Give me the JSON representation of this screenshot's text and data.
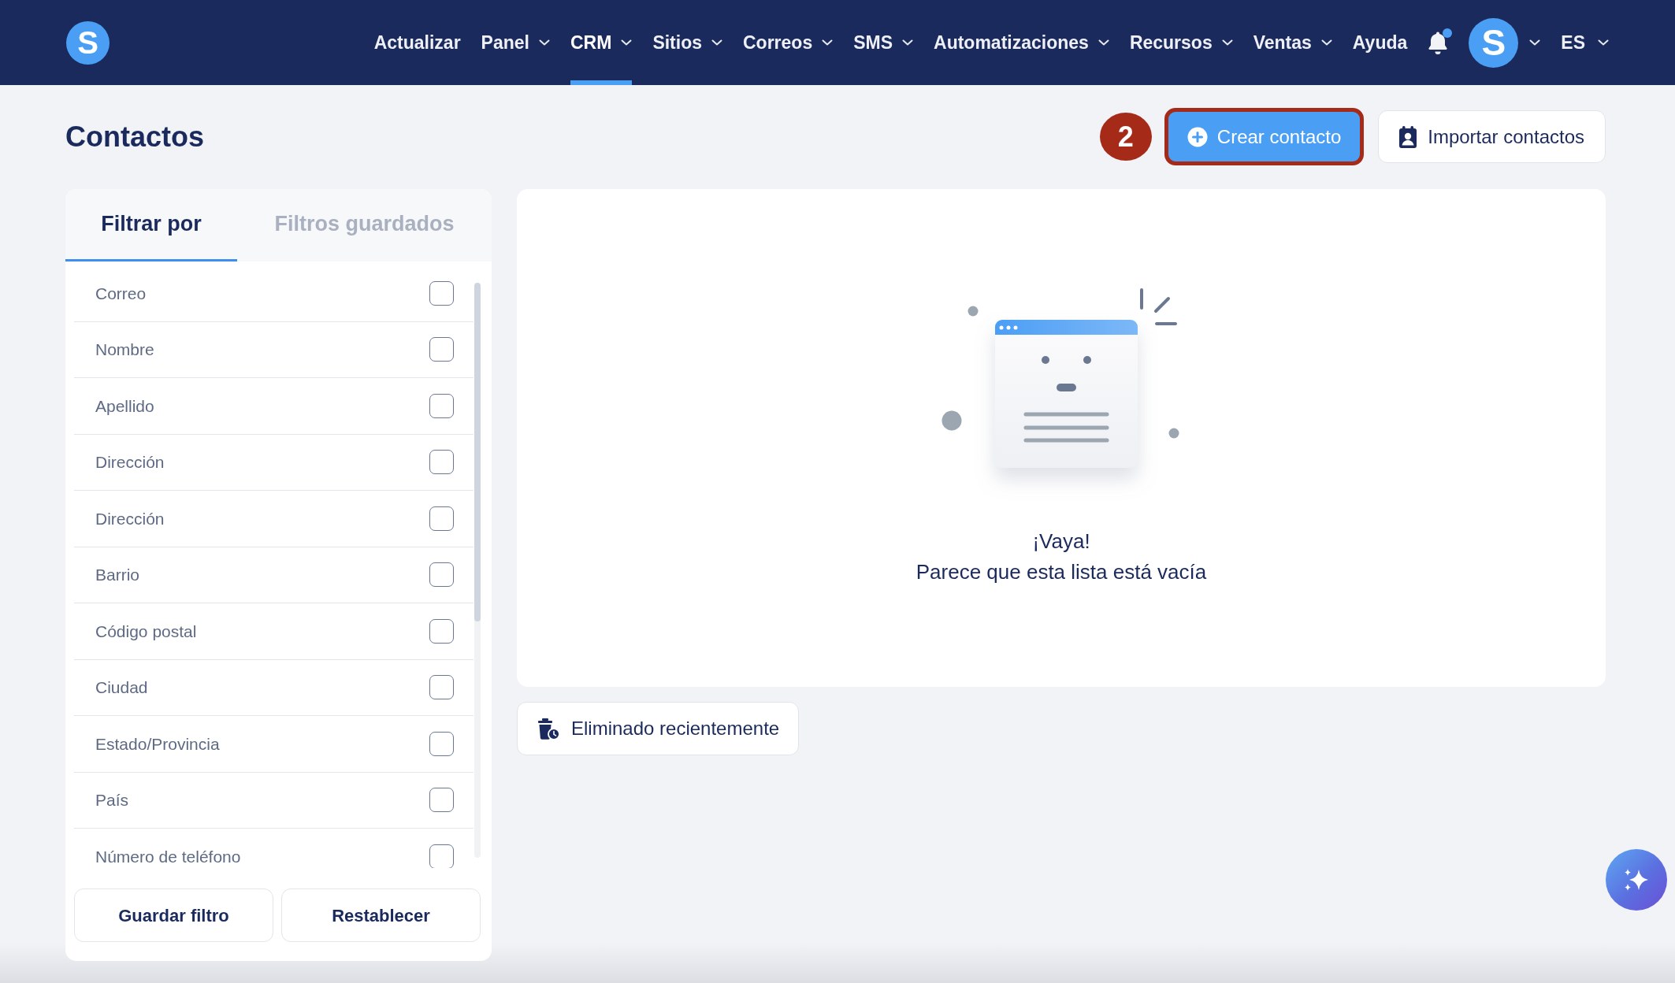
{
  "navbar": {
    "logo": "S",
    "items": [
      {
        "label": "Actualizar",
        "dropdown": false,
        "selected": false
      },
      {
        "label": "Panel",
        "dropdown": true,
        "selected": false
      },
      {
        "label": "CRM",
        "dropdown": true,
        "selected": true
      },
      {
        "label": "Sitios",
        "dropdown": true,
        "selected": false
      },
      {
        "label": "Correos",
        "dropdown": true,
        "selected": false
      },
      {
        "label": "SMS",
        "dropdown": true,
        "selected": false
      },
      {
        "label": "Automatizaciones",
        "dropdown": true,
        "selected": false
      },
      {
        "label": "Recursos",
        "dropdown": true,
        "selected": false
      },
      {
        "label": "Ventas",
        "dropdown": true,
        "selected": false
      },
      {
        "label": "Ayuda",
        "dropdown": false,
        "selected": false
      }
    ],
    "notification": {
      "unread": true
    },
    "avatar": {
      "initial": "S",
      "dropdown": true
    },
    "language": {
      "label": "ES",
      "dropdown": true
    }
  },
  "page": {
    "title": "Contactos",
    "step_marker": "2",
    "actions": [
      {
        "kind": "create",
        "label": "Crear contacto",
        "highlighted": true
      },
      {
        "kind": "import",
        "label": "Importar contactos",
        "highlighted": false
      }
    ]
  },
  "filters": {
    "tabs": [
      {
        "label": "Filtrar por",
        "selected": true
      },
      {
        "label": "Filtros guardados",
        "selected": false
      }
    ],
    "fields": [
      {
        "label": "Correo",
        "checked": false
      },
      {
        "label": "Nombre",
        "checked": false
      },
      {
        "label": "Apellido",
        "checked": false
      },
      {
        "label": "Dirección",
        "checked": false
      },
      {
        "label": "Dirección",
        "checked": false
      },
      {
        "label": "Barrio",
        "checked": false
      },
      {
        "label": "Código postal",
        "checked": false
      },
      {
        "label": "Ciudad",
        "checked": false
      },
      {
        "label": "Estado/Provincia",
        "checked": false
      },
      {
        "label": "País",
        "checked": false
      },
      {
        "label": "Número de teléfono",
        "checked": false
      }
    ],
    "buttons": [
      "Guardar filtro",
      "Restablecer"
    ]
  },
  "empty_state": {
    "title": "¡Vaya!",
    "message": "Parece que esta lista está vacía"
  },
  "recently_deleted": {
    "label": "Eliminado recientemente"
  }
}
